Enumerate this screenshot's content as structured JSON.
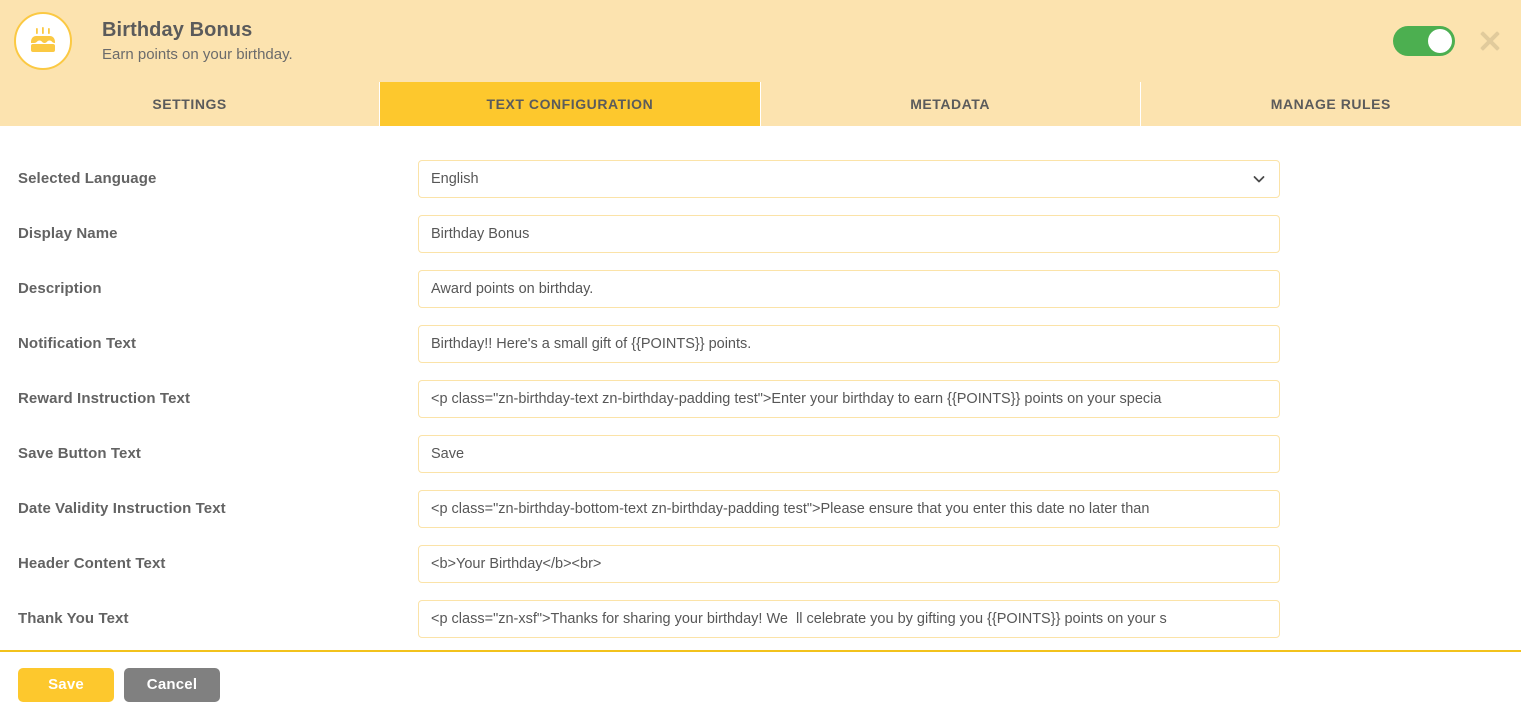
{
  "header": {
    "icon": "birthday-cake-icon",
    "title": "Birthday Bonus",
    "subtitle": "Earn points on your birthday.",
    "toggle_state": "on",
    "close_label": "close-icon",
    "bg_color": "#fce3af",
    "accent_color": "#fdc82d",
    "toggle_on_color": "#4caf50"
  },
  "tabs": [
    {
      "label": "SETTINGS",
      "active": false
    },
    {
      "label": "TEXT CONFIGURATION",
      "active": true
    },
    {
      "label": "METADATA",
      "active": false
    },
    {
      "label": "MANAGE RULES",
      "active": false
    }
  ],
  "form": {
    "rows": [
      {
        "label": "Selected Language",
        "type": "select",
        "value": "English",
        "options": [
          "English"
        ]
      },
      {
        "label": "Display Name",
        "type": "text",
        "value": "Birthday Bonus",
        "placeholder": ""
      },
      {
        "label": "Description",
        "type": "text",
        "value": "Award points on birthday.",
        "placeholder": ""
      },
      {
        "label": "Notification Text",
        "type": "text",
        "value": "Birthday!! Here's a small gift of {{POINTS}} points.",
        "placeholder": ""
      },
      {
        "label": "Reward Instruction Text",
        "type": "text",
        "value": "<p class=\"zn-birthday-text zn-birthday-padding test\">Enter your birthday to earn {{POINTS}} points on your specia",
        "placeholder": ""
      },
      {
        "label": "Save Button Text",
        "type": "text",
        "value": "Save",
        "placeholder": ""
      },
      {
        "label": "Date Validity Instruction Text",
        "type": "text",
        "value": "<p class=\"zn-birthday-bottom-text zn-birthday-padding test\">Please ensure that you enter this date no later than ",
        "placeholder": ""
      },
      {
        "label": "Header Content Text",
        "type": "text",
        "value": "<b>Your Birthday</b><br>",
        "placeholder": ""
      },
      {
        "label": "Thank You Text",
        "type": "text",
        "value": "<p class=\"zn-xsf\">Thanks for sharing your birthday! We  ll celebrate you by gifting you {{POINTS}} points on your s",
        "placeholder": ""
      }
    ]
  },
  "footer": {
    "save_label": "Save",
    "cancel_label": "Cancel",
    "save_color": "#fdc82d",
    "cancel_color": "#808080",
    "divider_color": "#f2c21c"
  }
}
